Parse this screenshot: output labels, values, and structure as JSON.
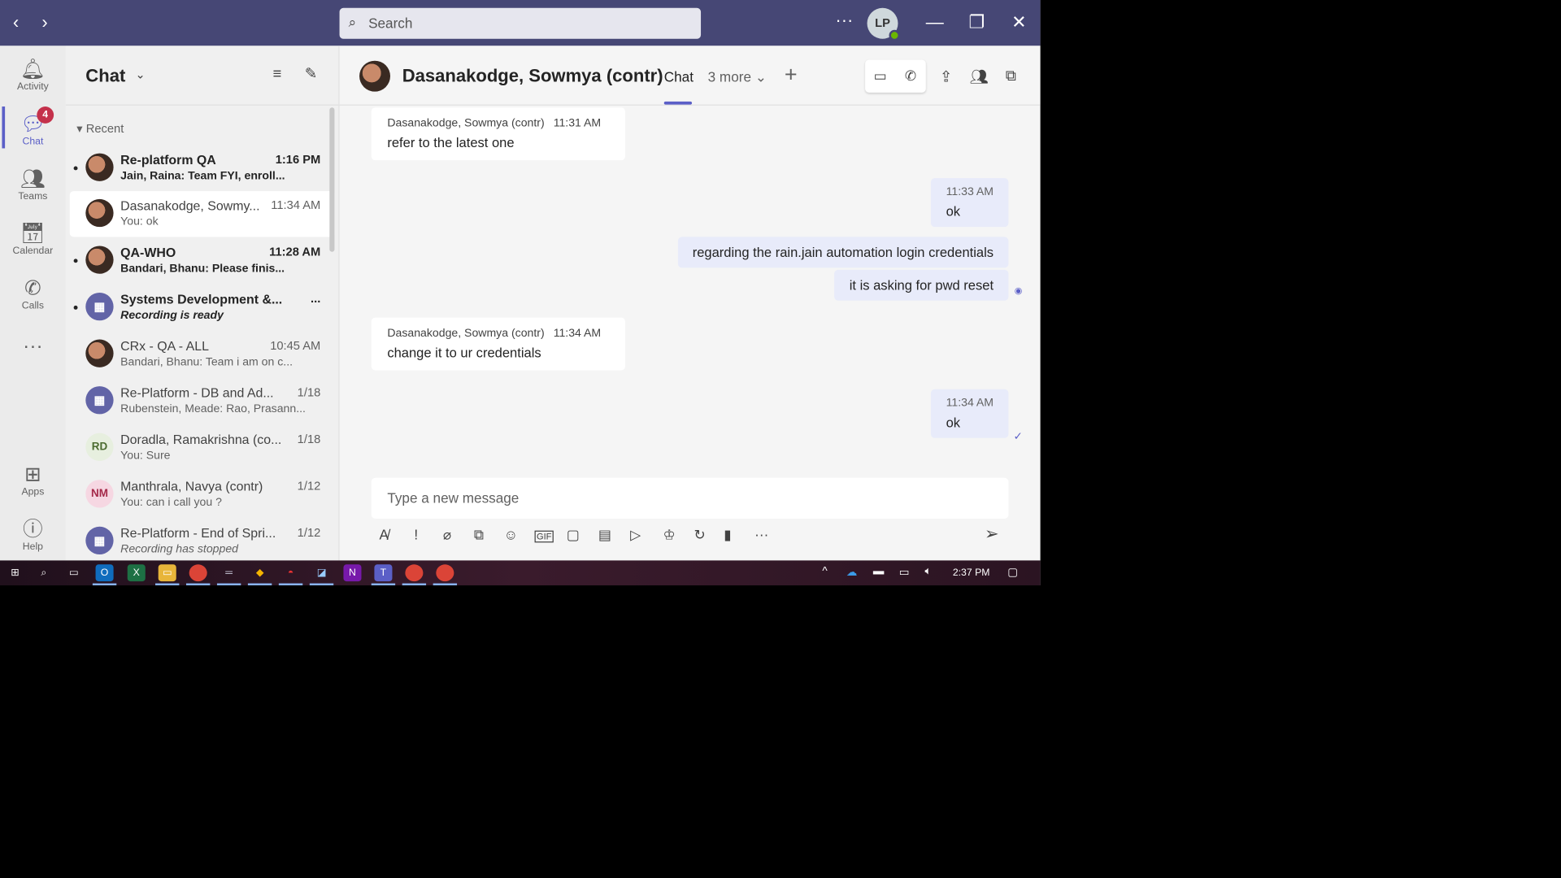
{
  "titlebar": {
    "search_placeholder": "Search",
    "user_initials": "LP"
  },
  "rail": [
    {
      "label": "Activity"
    },
    {
      "label": "Chat",
      "badge": "4"
    },
    {
      "label": "Teams"
    },
    {
      "label": "Calendar"
    },
    {
      "label": "Calls"
    },
    {
      "label": "Apps"
    },
    {
      "label": "Help"
    }
  ],
  "chat_list": {
    "title": "Chat",
    "section": "Recent",
    "items": [
      {
        "name": "Re-platform QA",
        "time": "1:16 PM",
        "preview": "Jain, Raina: Team FYI, enroll...",
        "unread": true
      },
      {
        "name": "Dasanakodge, Sowmy...",
        "time": "11:34 AM",
        "preview": "You: ok",
        "selected": true
      },
      {
        "name": "QA-WHO",
        "time": "11:28 AM",
        "preview": "Bandari, Bhanu: Please finis...",
        "unread": true
      },
      {
        "name": "Systems Development &...",
        "time": "...",
        "preview": "Recording is ready",
        "unread": true
      },
      {
        "name": "CRx - QA - ALL",
        "time": "10:45 AM",
        "preview": "Bandari, Bhanu: Team i am on c..."
      },
      {
        "name": "Re-Platform - DB and Ad...",
        "time": "1/18",
        "preview": "Rubenstein, Meade: Rao, Prasann..."
      },
      {
        "name": "Doradla, Ramakrishna (co...",
        "time": "1/18",
        "preview": "You: Sure",
        "initials": "RD"
      },
      {
        "name": "Manthrala, Navya (contr)",
        "time": "1/12",
        "preview": "You: can i call you ?",
        "initials": "NM"
      },
      {
        "name": "Re-Platform - End of Spri...",
        "time": "1/12",
        "preview": "Recording has stopped"
      }
    ]
  },
  "conversation": {
    "peer": "Dasanakodge, Sowmya (contr)",
    "tab_chat": "Chat",
    "tab_more": "3 more",
    "messages": [
      {
        "sender": "Dasanakodge, Sowmya (contr)",
        "time": "11:31 AM",
        "text": "refer to the latest one"
      },
      {
        "time": "11:33 AM",
        "text": "ok"
      },
      {
        "text": "regarding the rain.jain automation login credentials"
      },
      {
        "text": "it is asking for pwd reset"
      },
      {
        "sender": "Dasanakodge, Sowmya (contr)",
        "time": "11:34 AM",
        "text": "change it to ur credentials"
      },
      {
        "time": "11:34 AM",
        "text": "ok"
      }
    ],
    "compose_placeholder": "Type a new message"
  },
  "taskbar": {
    "clock": "2:37 PM"
  }
}
